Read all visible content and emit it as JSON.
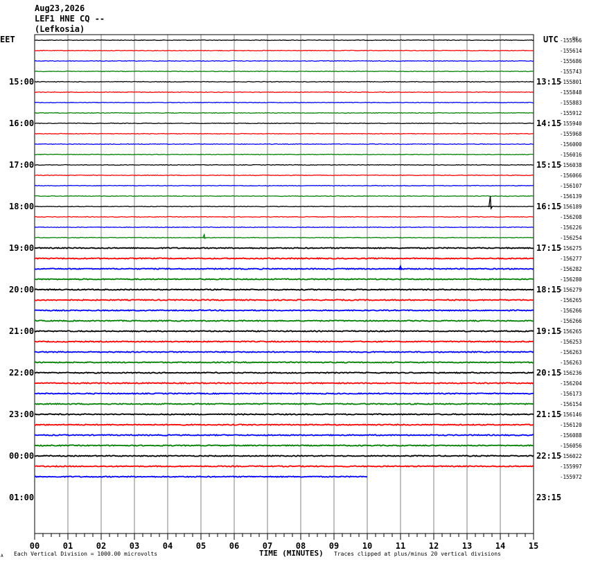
{
  "header": {
    "date": "Aug23,2026",
    "station": "LEF1 HNE CQ --",
    "location": "(Lefkosia)"
  },
  "left_tz": "EET",
  "right_tz": "UTC",
  "corner_mark": "DC",
  "footer": {
    "scale_note": "Each Vertical Division = 1000.00 microvolts",
    "xlabel": "TIME (MINUTES)",
    "clip_note": "Traces clipped at plus/minus 20 vertical divisions",
    "tiny_mark": "A"
  },
  "colors": {
    "line_cycle": [
      "#000000",
      "#ff0000",
      "#0000ff",
      "#008000"
    ],
    "grid": "#808080"
  },
  "chart_data": {
    "type": "line",
    "title": "",
    "xlabel": "TIME (MINUTES)",
    "ylabel": "",
    "xlim": [
      0,
      15
    ],
    "x_ticks": [
      "00",
      "01",
      "02",
      "03",
      "04",
      "05",
      "06",
      "07",
      "08",
      "09",
      "10",
      "11",
      "12",
      "13",
      "14",
      "15"
    ],
    "left_hour_labels": [
      "15:00",
      "16:00",
      "17:00",
      "18:00",
      "19:00",
      "20:00",
      "21:00",
      "22:00",
      "23:00",
      "00:00",
      "01:00"
    ],
    "right_hour_labels": [
      "13:15",
      "14:15",
      "15:15",
      "16:15",
      "17:15",
      "18:15",
      "19:15",
      "20:15",
      "21:15",
      "22:15",
      "23:15"
    ],
    "trace_offsets": [
      "-155566",
      "-155614",
      "-155686",
      "-155743",
      "-155801",
      "-155848",
      "-155883",
      "-155912",
      "-155940",
      "-155968",
      "-156000",
      "-156016",
      "-156038",
      "-156066",
      "-156107",
      "-156139",
      "-156189",
      "-156208",
      "-156226",
      "-156254",
      "-156275",
      "-156277",
      "-156282",
      "-156280",
      "-156279",
      "-156265",
      "-156266",
      "-156266",
      "-156265",
      "-156253",
      "-156263",
      "-156263",
      "-156236",
      "-156204",
      "-156173",
      "-156154",
      "-156146",
      "-156120",
      "-156088",
      "-156056",
      "-156022",
      "-155997",
      "-155972"
    ],
    "last_trace_end_minute": 10,
    "events": [
      {
        "trace": 16,
        "minute": 13.7,
        "amplitude_divisions": 1.0
      },
      {
        "trace": 19,
        "minute": 5.1,
        "amplitude_divisions": 0.3
      },
      {
        "trace": 22,
        "minute": 11.0,
        "amplitude_divisions": 0.25
      }
    ]
  }
}
